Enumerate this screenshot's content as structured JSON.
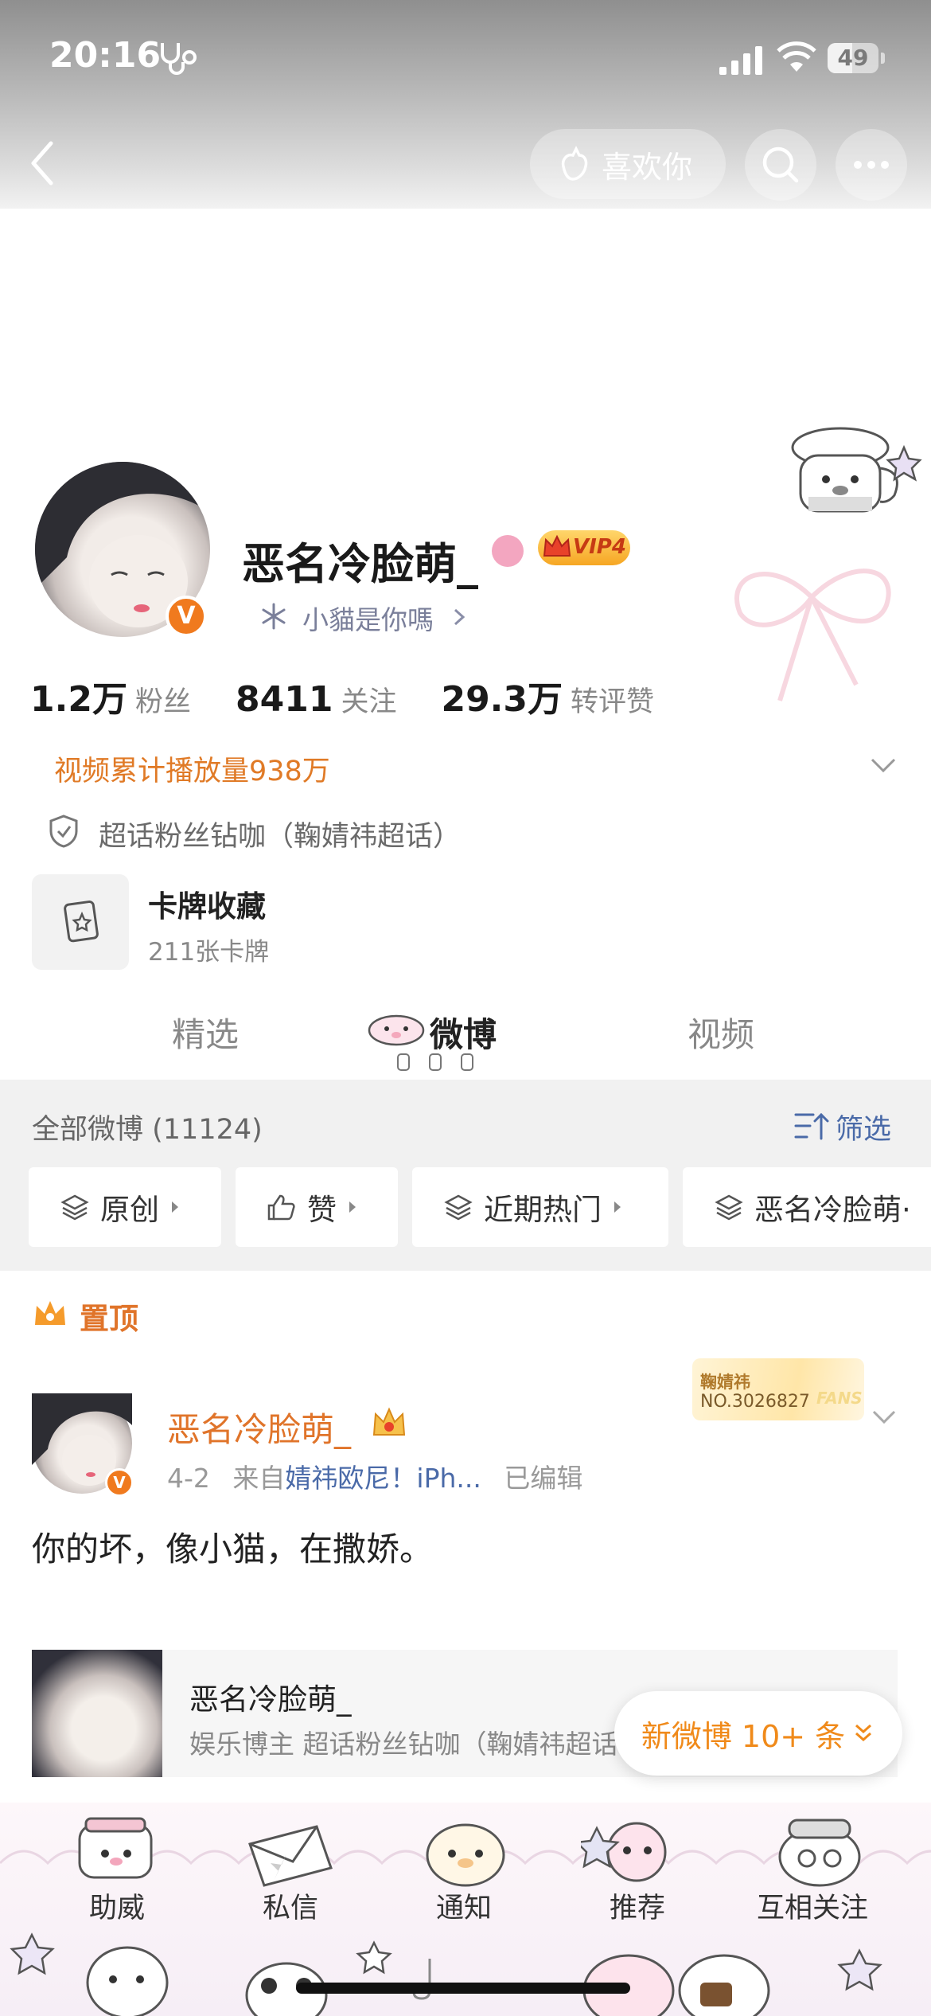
{
  "status_bar": {
    "time": "20:16",
    "battery": "49",
    "battery_fraction": 0.49
  },
  "header": {
    "like_label": "喜欢你"
  },
  "profile": {
    "username": "恶名冷脸萌_",
    "vip_label": "VIP4",
    "verify_mark": "V",
    "tagline": "小貓是你嗎",
    "stats": [
      {
        "value": "1.2万",
        "label": "粉丝"
      },
      {
        "value": "8411",
        "label": "关注"
      },
      {
        "value": "29.3万",
        "label": "转评赞"
      }
    ],
    "video_views": "视频累计播放量938万",
    "supertopic": "超话粉丝钻咖（鞠婧祎超话）",
    "cards": {
      "title": "卡牌收藏",
      "subtitle": "211张卡牌"
    }
  },
  "tabs": [
    {
      "label": "精选"
    },
    {
      "label": "微博"
    },
    {
      "label": "视频"
    }
  ],
  "filter": {
    "all_label": "全部微博 (11124)",
    "filter_label": "筛选",
    "chips": [
      {
        "label": "原创",
        "icon": "layers-icon"
      },
      {
        "label": "赞",
        "icon": "thumbs-up-icon"
      },
      {
        "label": "近期热门",
        "icon": "layers-icon"
      },
      {
        "label": "恶名冷脸萌·",
        "icon": "layers-icon"
      }
    ]
  },
  "post": {
    "pinned_label": "置顶",
    "author": "恶名冷脸萌_",
    "date": "4-2",
    "source_prefix": "来自",
    "source": "婧祎欧尼！iPh...",
    "edited": "已编辑",
    "fans_badge": {
      "name": "鞠婧祎",
      "number": "NO.3026827",
      "word": "FANS"
    },
    "text": "你的坏，像小猫，在撒娇。",
    "share_card": {
      "title": "恶名冷脸萌_",
      "subtitle": "娱乐博主 超话粉丝钻咖（鞠婧祎超话）"
    }
  },
  "new_posts_label": "新微博 10+ 条",
  "bottom_bar": {
    "items": [
      {
        "label": "助威"
      },
      {
        "label": "私信"
      },
      {
        "label": "通知"
      },
      {
        "label": "推荐"
      },
      {
        "label": "互相关注"
      }
    ]
  },
  "colors": {
    "accent_orange": "#e0742a",
    "link_blue": "#4a6aa8",
    "vip_gold": "#f6a623"
  }
}
